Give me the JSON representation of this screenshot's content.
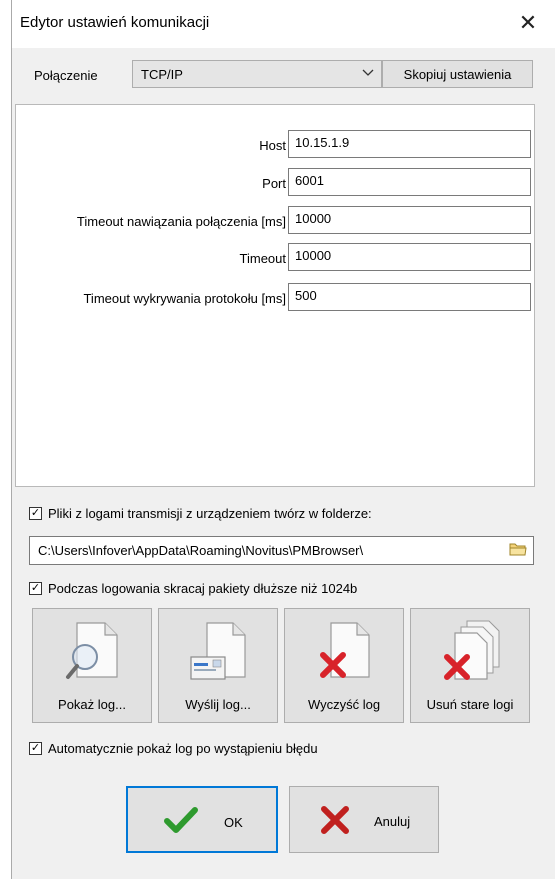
{
  "window": {
    "title": "Edytor ustawień komunikacji"
  },
  "connection": {
    "label": "Połączenie",
    "selected": "TCP/IP",
    "copy_label": "Skopiuj ustawienia"
  },
  "settings": {
    "fields": [
      {
        "label": "Host",
        "value": "10.15.1.9"
      },
      {
        "label": "Port",
        "value": "6001"
      },
      {
        "label": "Timeout nawiązania połączenia [ms]",
        "value": "10000"
      },
      {
        "label": "Timeout",
        "value": "10000"
      },
      {
        "label": "Timeout wykrywania protokołu [ms]",
        "value": "500"
      }
    ]
  },
  "logs": {
    "files_checkbox_label": "Pliki z logami transmisji z urządzeniem twórz w folderze:",
    "files_checked": true,
    "path": "C:\\Users\\Infover\\AppData\\Roaming\\Novitus\\PMBrowser\\",
    "truncate_checkbox_label": "Podczas logowania skracaj pakiety dłuższe niż 1024b",
    "truncate_checked": true,
    "buttons": [
      {
        "label": "Pokaż log...",
        "icon": "magnifier-document-icon"
      },
      {
        "label": "Wyślij log...",
        "icon": "envelope-document-icon"
      },
      {
        "label": "Wyczyść log",
        "icon": "delete-document-icon"
      },
      {
        "label": "Usuń stare logi",
        "icon": "delete-documents-icon"
      }
    ],
    "auto_show_checkbox_label": "Automatycznie pokaż log po wystąpieniu błędu",
    "auto_show_checked": true
  },
  "actions": {
    "ok_label": "OK",
    "cancel_label": "Anuluj"
  },
  "colors": {
    "ok_check": "#2e9a2e",
    "cancel_x": "#c0201e",
    "delete_x": "#d8232a"
  }
}
